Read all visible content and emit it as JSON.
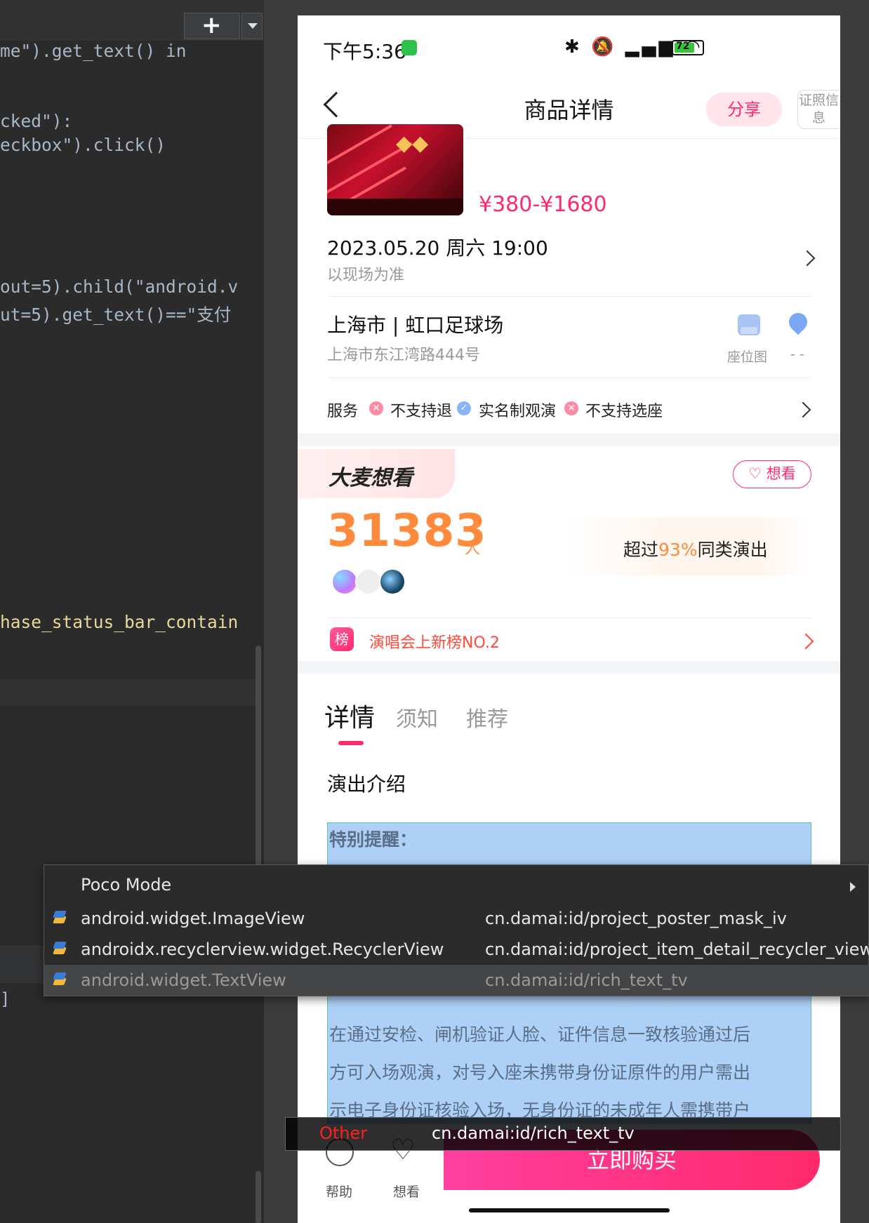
{
  "editor": {
    "lines": [
      "me\").get_text() in",
      "cked\"):",
      "eckbox\").click()",
      "out=5).child(\"android.v",
      "ut=5).get_text()==\"支付",
      "hase_status_bar_contain"
    ],
    "bracket": "]"
  },
  "status_bar": {
    "time": "下午5:36",
    "battery": "72"
  },
  "header": {
    "title": "商品详情",
    "share": "分享",
    "cert": "证照信息"
  },
  "product": {
    "price": "¥380-¥1680",
    "date": "2023.05.20 周六 19:00",
    "date_note": "以现场为准",
    "venue": "上海市 | 虹口足球场",
    "address": "上海市东江湾路444号",
    "seat_map": "座位图",
    "distance": "- -",
    "services_label": "服务",
    "services": [
      "不支持退",
      "实名制观演",
      "不支持选座"
    ]
  },
  "want_see": {
    "tag": "大麦想看",
    "button": "♡ 想看",
    "count": "31383",
    "unit": "人",
    "exceed_prefix": "超过",
    "exceed_pct": "93%",
    "exceed_suffix": "同类演出",
    "rank_icon": "榜",
    "rank": "演唱会上新榜NO.2"
  },
  "tabs": [
    "详情",
    "须知",
    "推荐"
  ],
  "intro_title": "演出介绍",
  "rich_text": {
    "heading": "特别提醒：",
    "lines": [
      "在通过安检、闸机验证人脸、证件信息一致核验通过后",
      "方可入场观演，对号入座未携带身份证原件的用户需出",
      "示电子身份证核验入场，无身份证的未成年人需携带户"
    ]
  },
  "bottom_bar": {
    "help": "帮助",
    "want": "想看",
    "buy": "立即购买"
  },
  "poco_tip": {
    "type": "Other",
    "id": "cn.damai:id/rich_text_tv"
  },
  "menu": {
    "title": "Poco Mode",
    "items": [
      {
        "class": "android.widget.ImageView",
        "id": "cn.damai:id/project_poster_mask_iv"
      },
      {
        "class": "androidx.recyclerview.widget.RecyclerView",
        "id": "cn.damai:id/project_item_detail_recycler_view"
      },
      {
        "class": "android.widget.TextView",
        "id": "cn.damai:id/rich_text_tv"
      }
    ]
  },
  "colors": {
    "accent": "#ff2a6b",
    "orange": "#ff8a3c",
    "selection": "#aed0f7"
  }
}
